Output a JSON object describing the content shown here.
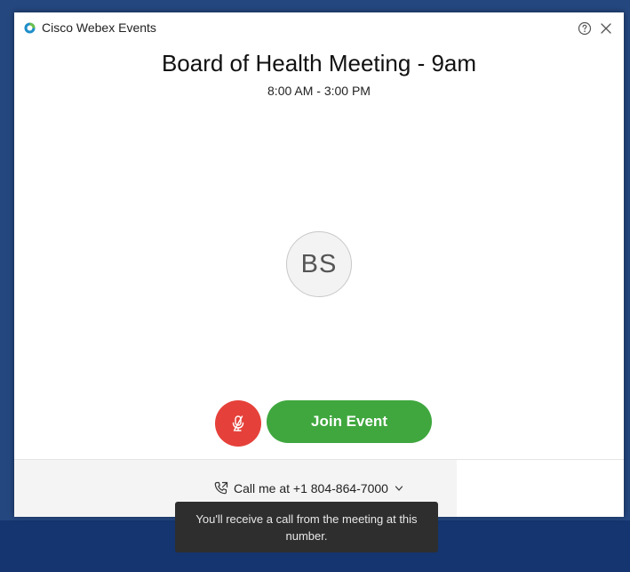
{
  "window": {
    "app_title": "Cisco Webex Events",
    "help_label": "?",
    "close_label": "×"
  },
  "meeting": {
    "title": "Board of Health Meeting - 9am",
    "time": "8:00 AM - 3:00 PM"
  },
  "avatar": {
    "initials": "BS"
  },
  "controls": {
    "join_label": "Join Event",
    "mute_state": "muted"
  },
  "audio": {
    "call_me_label": "Call me at +1 804-864-7000",
    "tooltip": "You'll receive a call from the meeting at this number."
  },
  "colors": {
    "join_green": "#3fa73e",
    "mute_red": "#e5413a",
    "desktop_blue": "#24477f"
  },
  "icons": [
    "webex-logo-icon",
    "help-icon",
    "close-icon",
    "microphone-muted-icon",
    "phone-icon",
    "chevron-down-icon"
  ]
}
